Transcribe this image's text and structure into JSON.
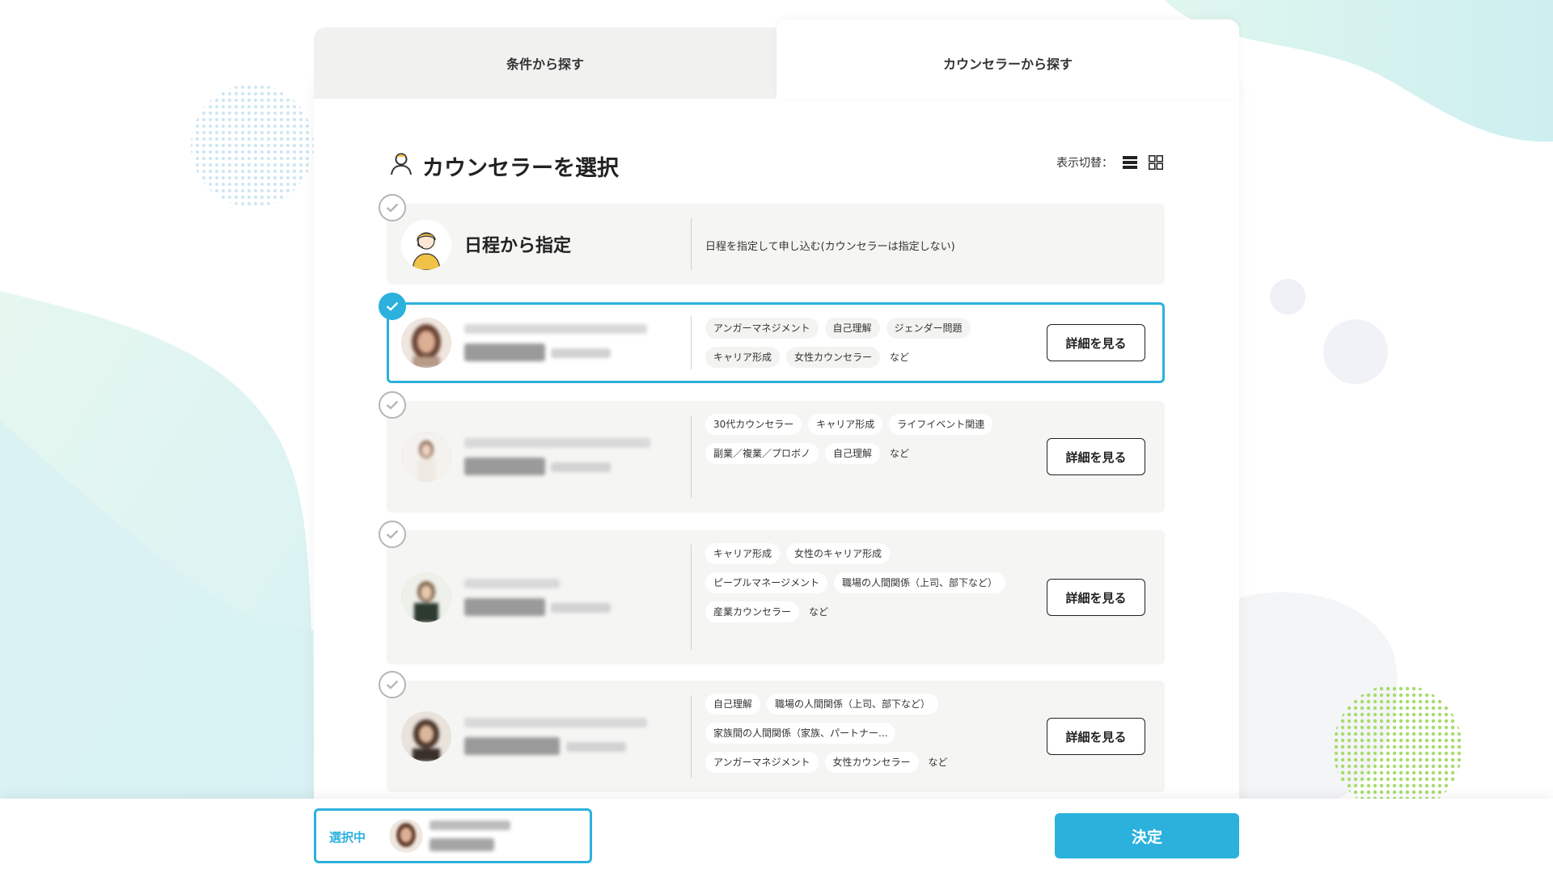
{
  "tabs": {
    "by_condition": "条件から探す",
    "by_counselor": "カウンセラーから探す"
  },
  "section": {
    "title": "カウンセラーを選択",
    "view_toggle_label": "表示切替："
  },
  "schedule_option": {
    "title": "日程から指定",
    "description": "日程を指定して申し込む(カウンセラーは指定しない)"
  },
  "counselors": [
    {
      "selected": true,
      "tags": [
        "アンガーマネジメント",
        "自己理解",
        "ジェンダー問題",
        "キャリア形成",
        "女性カウンセラー"
      ],
      "more": "など",
      "detail_label": "詳細を見る"
    },
    {
      "selected": false,
      "tags": [
        "30代カウンセラー",
        "キャリア形成",
        "ライフイベント関連",
        "副業／複業／プロボノ",
        "自己理解"
      ],
      "more": "など",
      "detail_label": "詳細を見る"
    },
    {
      "selected": false,
      "tags": [
        "キャリア形成",
        "女性のキャリア形成",
        "ピープルマネージメント",
        "職場の人間関係（上司、部下など）",
        "産業カウンセラー"
      ],
      "more": "など",
      "detail_label": "詳細を見る"
    },
    {
      "selected": false,
      "tags": [
        "自己理解",
        "職場の人間関係（上司、部下など）",
        "家族間の人間関係（家族、パートナー...",
        "アンガーマネジメント",
        "女性カウンセラー"
      ],
      "more": "など",
      "detail_label": "詳細を見る"
    }
  ],
  "bottom": {
    "selected_label": "選択中",
    "confirm_label": "決定"
  },
  "colors": {
    "accent": "#2bb1dc",
    "card_bg": "#f5f5f3",
    "tab_inactive": "#f1f1f0"
  }
}
